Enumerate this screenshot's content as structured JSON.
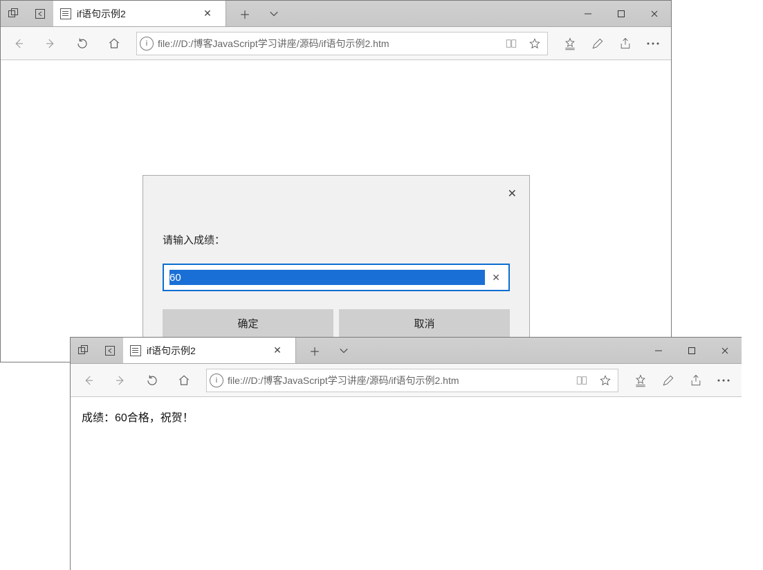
{
  "window1": {
    "tab_title": "if语句示例2",
    "url": "file:///D:/博客JavaScript学习讲座/源码/if语句示例2.htm",
    "dialog": {
      "prompt_label": "请输入成绩：",
      "input_value": "60",
      "ok_label": "确定",
      "cancel_label": "取消"
    }
  },
  "window2": {
    "tab_title": "if语句示例2",
    "url": "file:///D:/博客JavaScript学习讲座/源码/if语句示例2.htm",
    "result_text": "成绩：60合格，祝贺！"
  }
}
